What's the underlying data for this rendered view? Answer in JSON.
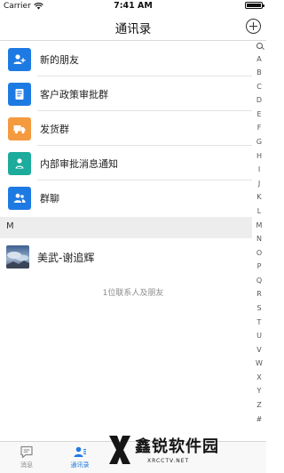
{
  "status_bar": {
    "carrier": "Carrier",
    "time": "7:41 AM"
  },
  "header": {
    "title": "通讯录"
  },
  "function_rows": [
    {
      "label": "新的朋友",
      "icon": "add-user-icon",
      "color": "#1e7ae3"
    },
    {
      "label": "客户政策审批群",
      "icon": "document-icon",
      "color": "#1e7ae3"
    },
    {
      "label": "发货群",
      "icon": "truck-icon",
      "color": "#f49a3f"
    },
    {
      "label": "内部审批消息通知",
      "icon": "user-check-icon",
      "color": "#1dab9c"
    },
    {
      "label": "群聊",
      "icon": "group-icon",
      "color": "#1e7ae3"
    }
  ],
  "section": {
    "letter": "M"
  },
  "contacts": [
    {
      "name": "美武-谢追辉",
      "avatar": "sky-photo-avatar"
    }
  ],
  "footer": {
    "count_text": "1位联系人及朋友"
  },
  "index_letters": [
    "A",
    "B",
    "C",
    "D",
    "E",
    "F",
    "G",
    "H",
    "I",
    "J",
    "K",
    "L",
    "M",
    "N",
    "O",
    "P",
    "Q",
    "R",
    "S",
    "T",
    "U",
    "V",
    "W",
    "X",
    "Y",
    "Z",
    "#"
  ],
  "tabs": [
    {
      "label": "消息",
      "icon": "chat-icon",
      "active": false
    },
    {
      "label": "通讯录",
      "icon": "contacts-icon",
      "active": true
    }
  ],
  "watermark": {
    "name": "鑫锐软件园",
    "site": "XRCCTV.NET"
  }
}
